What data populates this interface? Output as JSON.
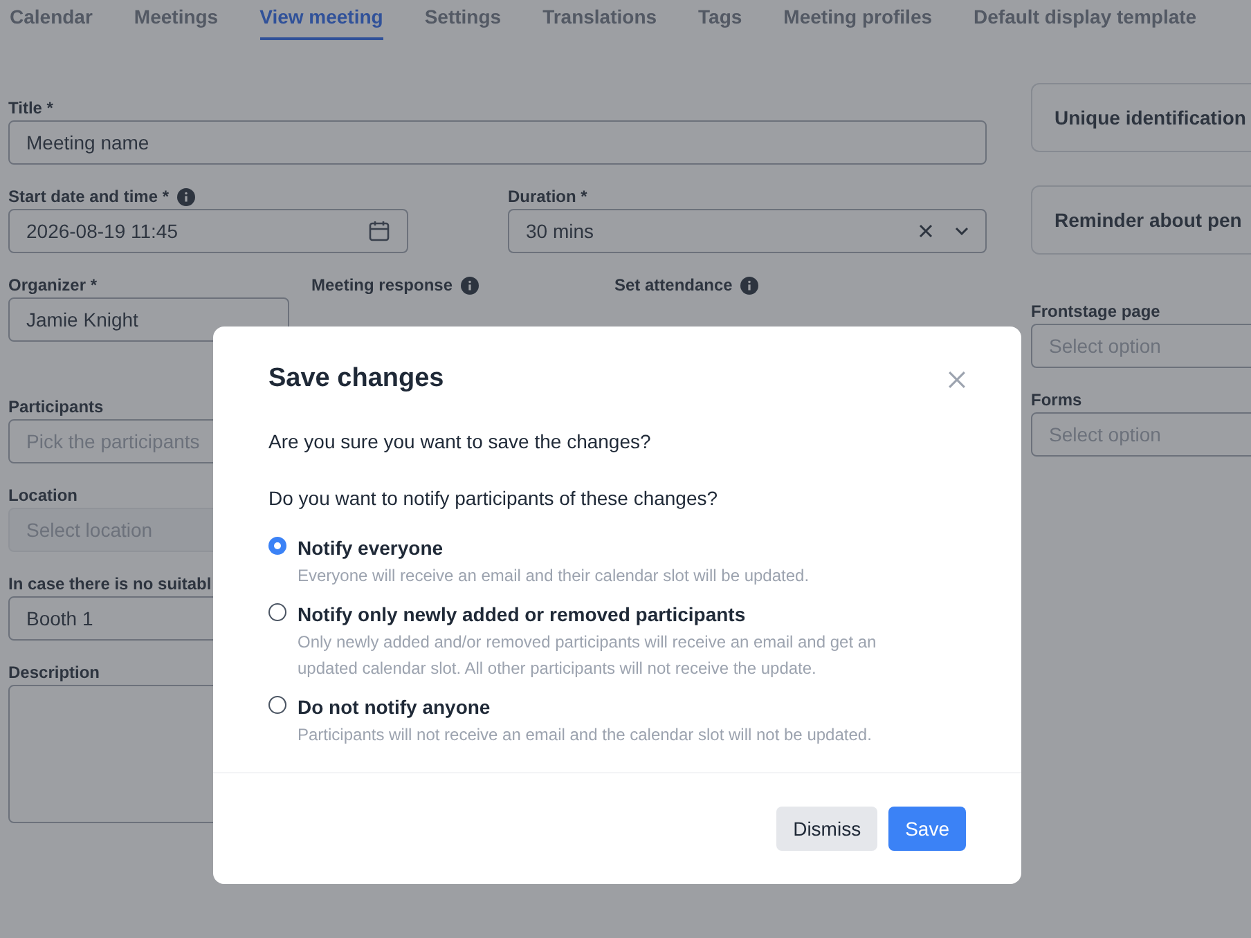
{
  "tabs": [
    {
      "label": "Calendar",
      "selected": false
    },
    {
      "label": "Meetings",
      "selected": false
    },
    {
      "label": "View meeting",
      "selected": true
    },
    {
      "label": "Settings",
      "selected": false
    },
    {
      "label": "Translations",
      "selected": false
    },
    {
      "label": "Tags",
      "selected": false
    },
    {
      "label": "Meeting profiles",
      "selected": false
    },
    {
      "label": "Default display template",
      "selected": false
    }
  ],
  "form": {
    "rows": [
      [
        {
          "label": "Title *",
          "info": false,
          "kind": "text",
          "value": "Meeting name"
        }
      ],
      [
        {
          "label": "Start date and time *",
          "info": true,
          "kind": "date",
          "value": "2026-08-19 11:45"
        },
        {
          "label": "Duration *",
          "info": false,
          "kind": "select",
          "value": "30 mins"
        }
      ],
      [
        {
          "label": "Organizer *",
          "info": false,
          "kind": "text",
          "value": "Jamie Knight"
        },
        {
          "label": "Meeting response",
          "info": true,
          "kind": "label"
        },
        {
          "label": "Set attendance",
          "info": true,
          "kind": "label"
        }
      ],
      [
        {
          "label": "Participants",
          "info": false,
          "kind": "text",
          "placeholder": "Pick the participants"
        }
      ],
      [
        {
          "label": "Location",
          "info": false,
          "kind": "disabled",
          "placeholder": "Select location"
        }
      ],
      [
        {
          "label": "In case there is no suitabl",
          "kind": "text",
          "value": "Booth 1"
        }
      ],
      [
        {
          "label": "Description",
          "info": false,
          "kind": "textarea"
        }
      ]
    ]
  },
  "sidebar": {
    "cards": [
      "Unique identification",
      "Reminder about pen"
    ],
    "fields": [
      {
        "label": "Frontstage page",
        "placeholder": "Select option"
      },
      {
        "label": "Forms",
        "placeholder": "Select option"
      }
    ]
  },
  "dialog": {
    "title": "Save changes",
    "question": "Are you sure you want to save the changes?",
    "prompt": "Do you want to notify participants of these changes?",
    "options": [
      {
        "label": "Notify everyone",
        "description": "Everyone will receive an email and their calendar slot will be updated.",
        "selected": true
      },
      {
        "label": "Notify only newly added or removed participants",
        "description": "Only newly added and/or removed participants will receive an email and get an updated calendar slot. All other participants will not receive the update.",
        "selected": false
      },
      {
        "label": "Do not notify anyone",
        "description": "Participants will not receive an email and the calendar slot will not be updated.",
        "selected": false
      }
    ],
    "buttons": [
      {
        "label": "Dismiss",
        "kind": "secondary"
      },
      {
        "label": "Save",
        "kind": "primary"
      }
    ]
  }
}
